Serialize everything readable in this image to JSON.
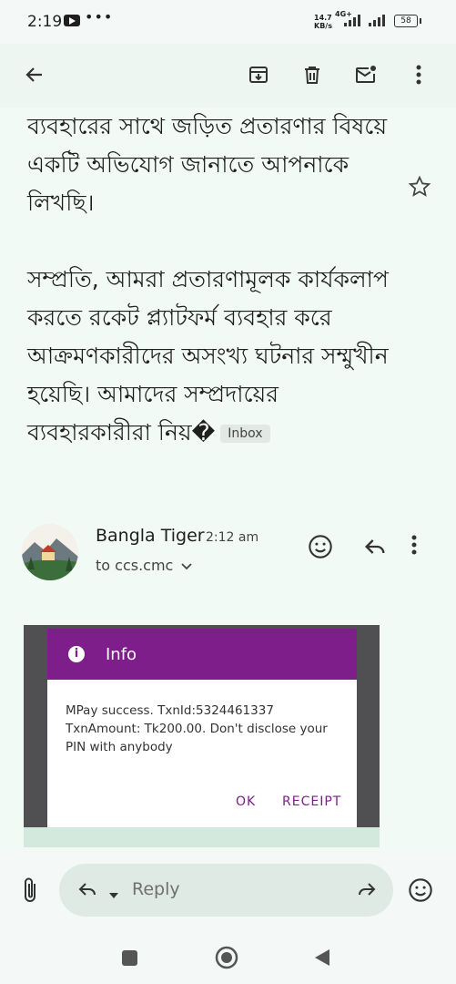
{
  "status_bar": {
    "time": "2:19",
    "more": "•••",
    "net_speed_value": "14.7",
    "net_speed_unit": "KB/s",
    "network": "4G+",
    "battery": "58"
  },
  "email": {
    "paragraph_1": "ব্যবহারের সাথে জড়িত প্রতারণার বিষয়ে একটি অভিযোগ জানাতে আপনাকে লিখছি।",
    "paragraph_2": "সম্প্রতি, আমরা প্রতারণামূলক কার্যকলাপ করতে রকেট প্ল্যাটফর্ম ব্যবহার করে আক্রমণকারীদের অসংখ্য ঘটনার সম্মুখীন হয়েছি। আমাদের সম্প্রদায়ের ব্যবহারকারীরা নিয়�",
    "label_chip": "Inbox"
  },
  "message": {
    "sender_name": "Bangla Tiger",
    "time": "2:12 am",
    "recipient": "to ccs.cmc"
  },
  "embedded_dialog": {
    "title": "Info",
    "message": "MPay success. TxnId:5324461337\nTxnAmount: Tk200.00. Don't disclose your\nPIN with anybody",
    "ok_label": "OK",
    "receipt_label": "RECEIPT"
  },
  "reply_bar": {
    "reply_label": "Reply"
  },
  "colors": {
    "accent": "#7e1e8a",
    "background": "#f2faf5"
  }
}
